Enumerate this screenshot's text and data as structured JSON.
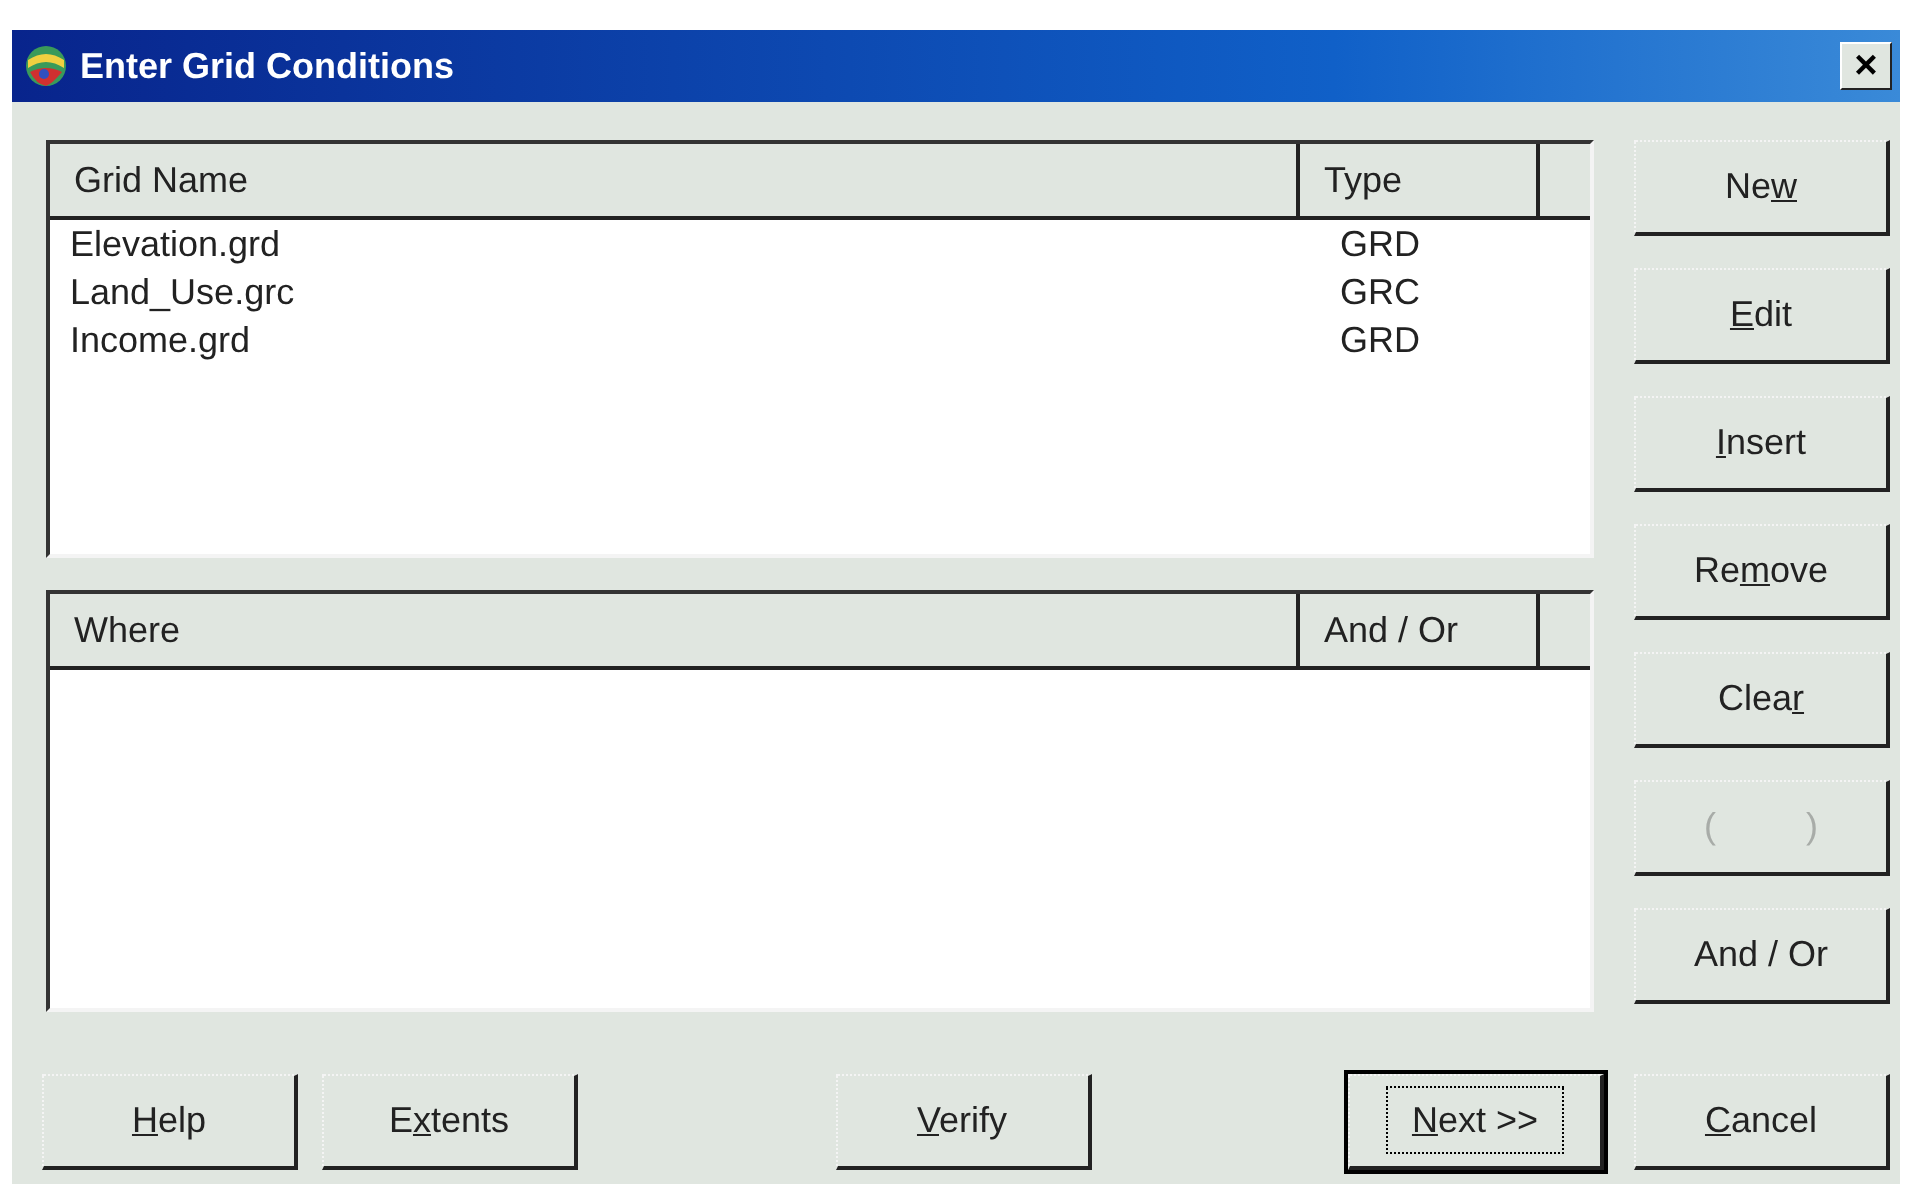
{
  "window": {
    "title": "Enter Grid Conditions",
    "close": "×"
  },
  "grid_table": {
    "columns": [
      "Grid Name",
      "Type"
    ],
    "rows": [
      {
        "cells": [
          "Elevation.grd",
          "GRD"
        ],
        "selected": false
      },
      {
        "cells": [
          "Land_Use.grc",
          "GRC"
        ],
        "selected": false
      },
      {
        "cells": [
          "Income.grd",
          "GRD"
        ],
        "selected": false
      }
    ]
  },
  "where_table": {
    "columns": [
      "Where",
      "And / Or"
    ]
  },
  "side_buttons": [
    {
      "label": [
        {
          "text": "Ne",
          "underlined": false
        },
        {
          "text": "w",
          "underlined": true
        }
      ],
      "disabled": false
    },
    {
      "label": [
        {
          "text": "E",
          "underlined": true
        },
        {
          "text": "dit",
          "underlined": false
        }
      ],
      "disabled": false
    },
    {
      "label": [
        {
          "text": "I",
          "underlined": true
        },
        {
          "text": "nsert",
          "underlined": false
        }
      ],
      "disabled": false
    },
    {
      "label": [
        {
          "text": "Re",
          "underlined": false
        },
        {
          "text": "m",
          "underlined": true
        },
        {
          "text": "ove",
          "underlined": false
        }
      ],
      "disabled": false
    },
    {
      "label": [
        {
          "text": "Clea",
          "underlined": false
        },
        {
          "text": "r",
          "underlined": true
        }
      ],
      "disabled": false
    },
    {
      "label": [
        {
          "text": "(         )",
          "underlined": false
        }
      ],
      "disabled": true
    },
    {
      "label": [
        {
          "text": "And / Or",
          "underlined": false
        }
      ],
      "disabled": false
    }
  ],
  "bottom_buttons": {
    "left": [
      {
        "label": [
          {
            "text": "H",
            "underlined": true
          },
          {
            "text": "elp",
            "underlined": false
          }
        ],
        "default": false
      },
      {
        "label": [
          {
            "text": "E",
            "underlined": false
          },
          {
            "text": "x",
            "underlined": true
          },
          {
            "text": "tents",
            "underlined": false
          }
        ],
        "default": false
      }
    ],
    "middle": [
      {
        "label": [
          {
            "text": "V",
            "underlined": true
          },
          {
            "text": "erify",
            "underlined": false
          }
        ],
        "default": false
      }
    ],
    "right": [
      {
        "label": [
          {
            "text": "N",
            "underlined": true
          },
          {
            "text": "ext >>",
            "underlined": false
          }
        ],
        "default": true
      },
      {
        "label": [
          {
            "text": "C",
            "underlined": true
          },
          {
            "text": "ancel",
            "underlined": false
          }
        ],
        "default": false
      }
    ]
  }
}
